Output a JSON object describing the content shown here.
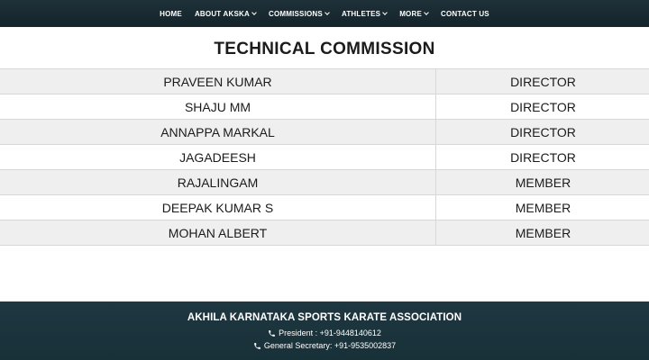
{
  "nav": {
    "items": [
      {
        "label": "HOME",
        "dropdown": false
      },
      {
        "label": "ABOUT AKSKA",
        "dropdown": true
      },
      {
        "label": "COMMISSIONS",
        "dropdown": true
      },
      {
        "label": "ATHLETES",
        "dropdown": true
      },
      {
        "label": "MORE",
        "dropdown": true
      },
      {
        "label": "CONTACT US",
        "dropdown": false
      }
    ]
  },
  "main": {
    "title": "TECHNICAL COMMISSION",
    "rows": [
      {
        "name": "PRAVEEN KUMAR",
        "role": "DIRECTOR"
      },
      {
        "name": "SHAJU MM",
        "role": "DIRECTOR"
      },
      {
        "name": "ANNAPPA MARKAL",
        "role": "DIRECTOR"
      },
      {
        "name": "JAGADEESH",
        "role": "DIRECTOR"
      },
      {
        "name": "RAJALINGAM",
        "role": "MEMBER"
      },
      {
        "name": "DEEPAK KUMAR S",
        "role": "MEMBER"
      },
      {
        "name": "MOHAN ALBERT",
        "role": "MEMBER"
      }
    ]
  },
  "footer": {
    "title": "AKHILA KARNATAKA SPORTS KARATE ASSOCIATION",
    "president": "President : +91-9448140612",
    "secretary": "General Secretary: +91-9535002837",
    "icon": "phone-icon"
  },
  "colors": {
    "header_bg": "#1e3038",
    "footer_bg": "#1f3740",
    "row_stripe": "#efefef"
  }
}
